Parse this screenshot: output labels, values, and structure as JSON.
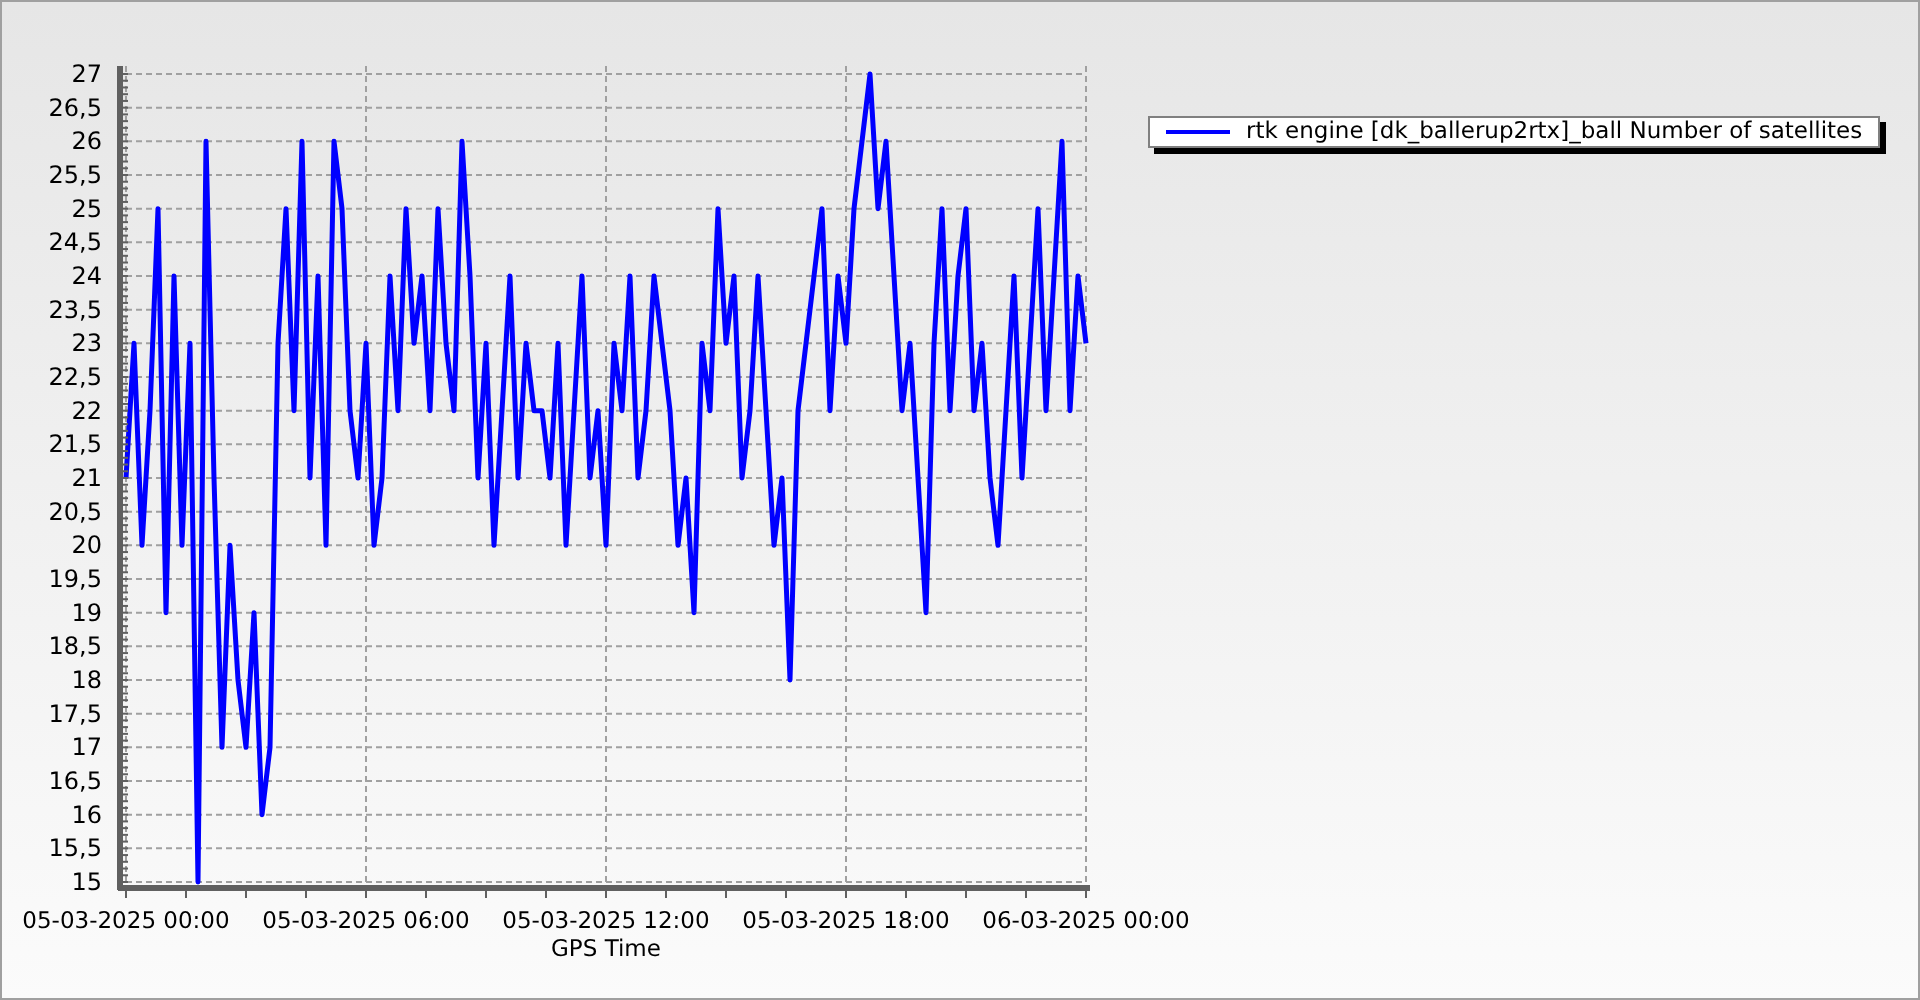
{
  "chart_data": {
    "type": "line",
    "grid": true,
    "xlabel": "GPS Time",
    "categories": [
      "05-03-2025 00:00",
      null,
      null,
      null,
      null,
      null,
      null,
      null,
      null,
      null,
      null,
      null,
      null,
      null,
      null,
      null,
      null,
      null,
      null,
      null,
      null,
      null,
      null,
      null,
      null,
      null,
      null,
      null,
      null,
      null,
      "05-03-2025 06:00",
      null,
      null,
      null,
      null,
      null,
      null,
      null,
      null,
      null,
      null,
      null,
      null,
      null,
      null,
      null,
      null,
      null,
      null,
      null,
      null,
      null,
      null,
      null,
      null,
      null,
      null,
      null,
      null,
      null,
      "05-03-2025 12:00",
      null,
      null,
      null,
      null,
      null,
      null,
      null,
      null,
      null,
      null,
      null,
      null,
      null,
      null,
      null,
      null,
      null,
      null,
      null,
      null,
      null,
      null,
      null,
      null,
      null,
      null,
      null,
      null,
      null,
      "05-03-2025 18:00",
      null,
      null,
      null,
      null,
      null,
      null,
      null,
      null,
      null,
      null,
      null,
      null,
      null,
      null,
      null,
      null,
      null,
      null,
      null,
      null,
      null,
      null,
      null,
      null,
      null,
      null,
      null,
      null,
      null,
      "06-03-2025 00:00"
    ],
    "series": [
      {
        "name": "rtk engine [dk_ballerup2rtx]_ball Number of satellites",
        "color": "#0000ff",
        "values": [
          21,
          23,
          20,
          22,
          25,
          19,
          24,
          20,
          23,
          15,
          26,
          21,
          17,
          20,
          18,
          17,
          19,
          16,
          17,
          23,
          25,
          22,
          26,
          21,
          24,
          20,
          26,
          25,
          22,
          21,
          23,
          20,
          21,
          24,
          22,
          25,
          23,
          24,
          22,
          25,
          23,
          22,
          26,
          24,
          21,
          23,
          20,
          22,
          24,
          21,
          23,
          22,
          22,
          21,
          23,
          20,
          22,
          24,
          21,
          22,
          20,
          23,
          22,
          24,
          21,
          22,
          24,
          23,
          22,
          20,
          21,
          19,
          23,
          22,
          25,
          23,
          24,
          21,
          22,
          24,
          22,
          20,
          21,
          18,
          22,
          23,
          24,
          25,
          22,
          24,
          23,
          25,
          26,
          27,
          25,
          26,
          24,
          22,
          23,
          21,
          19,
          23,
          25,
          22,
          24,
          25,
          22,
          23,
          21,
          20,
          22,
          24,
          21,
          23,
          25,
          22,
          24,
          26,
          22,
          24,
          23
        ]
      }
    ],
    "ylim": [
      15,
      27
    ],
    "yticks": [
      {
        "value": 15,
        "label": "15"
      },
      {
        "value": 15.5,
        "label": "15,5"
      },
      {
        "value": 16,
        "label": "16"
      },
      {
        "value": 16.5,
        "label": "16,5"
      },
      {
        "value": 17,
        "label": "17"
      },
      {
        "value": 17.5,
        "label": "17,5"
      },
      {
        "value": 18,
        "label": "18"
      },
      {
        "value": 18.5,
        "label": "18,5"
      },
      {
        "value": 19,
        "label": "19"
      },
      {
        "value": 19.5,
        "label": "19,5"
      },
      {
        "value": 20,
        "label": "20"
      },
      {
        "value": 20.5,
        "label": "20,5"
      },
      {
        "value": 21,
        "label": "21"
      },
      {
        "value": 21.5,
        "label": "21,5"
      },
      {
        "value": 22,
        "label": "22"
      },
      {
        "value": 22.5,
        "label": "22,5"
      },
      {
        "value": 23,
        "label": "23"
      },
      {
        "value": 23.5,
        "label": "23,5"
      },
      {
        "value": 24,
        "label": "24"
      },
      {
        "value": 24.5,
        "label": "24,5"
      },
      {
        "value": 25,
        "label": "25"
      },
      {
        "value": 25.5,
        "label": "25,5"
      },
      {
        "value": 26,
        "label": "26"
      },
      {
        "value": 26.5,
        "label": "26,5"
      },
      {
        "value": 27,
        "label": "27"
      }
    ]
  }
}
